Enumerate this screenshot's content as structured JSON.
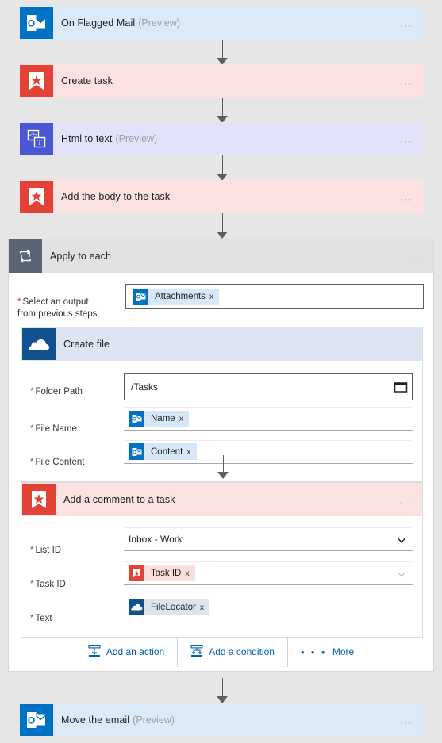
{
  "flow": {
    "steps": [
      {
        "id": "on-flagged-mail",
        "title": "On Flagged Mail",
        "suffix": "(Preview)",
        "connector": "outlook",
        "icon": "outlook-icon",
        "menu": "..."
      },
      {
        "id": "create-task",
        "title": "Create task",
        "suffix": "",
        "connector": "wunderlist",
        "icon": "wunderlist-icon",
        "menu": "..."
      },
      {
        "id": "html-to-text",
        "title": "Html to text",
        "suffix": "(Preview)",
        "connector": "html",
        "icon": "html-to-text-icon",
        "menu": "..."
      },
      {
        "id": "add-body-to-task",
        "title": "Add the body to the task",
        "suffix": "",
        "connector": "wunderlist",
        "icon": "wunderlist-icon",
        "menu": "..."
      },
      {
        "id": "move-the-email",
        "title": "Move the email",
        "suffix": "(Preview)",
        "connector": "outlook",
        "icon": "outlook-icon",
        "menu": "..."
      }
    ]
  },
  "loop": {
    "title": "Apply to each",
    "icon": "loop-icon",
    "menu": "...",
    "output_field": {
      "label": "Select an output\nfrom previous steps",
      "required": true,
      "token": {
        "text": "Attachments",
        "icon": "outlook-icon",
        "remove": "x"
      }
    },
    "actions": {
      "add_action": "Add an action",
      "add_action_icon": "add-action-icon",
      "add_condition": "Add a condition",
      "add_condition_icon": "add-condition-icon",
      "more": "More",
      "more_icon": "more-dots-icon"
    }
  },
  "create_file": {
    "title": "Create file",
    "suffix": "",
    "icon": "onedrive-icon",
    "menu": "...",
    "fields": [
      {
        "label": "Folder Path",
        "required": true,
        "type": "text",
        "value": "/Tasks",
        "trailing_icon": "folder-picker-icon"
      },
      {
        "label": "File Name",
        "required": true,
        "type": "token",
        "token": {
          "text": "Name",
          "icon": "outlook-icon",
          "remove": "x"
        }
      },
      {
        "label": "File Content",
        "required": true,
        "type": "token",
        "token": {
          "text": "Content",
          "icon": "outlook-icon",
          "remove": "x"
        }
      }
    ]
  },
  "add_comment": {
    "title": "Add a comment to a task",
    "suffix": "",
    "icon": "wunderlist-icon",
    "menu": "...",
    "fields": [
      {
        "label": "List ID",
        "required": true,
        "type": "select",
        "value": "Inbox - Work",
        "trailing_icon": "chevron-down-icon"
      },
      {
        "label": "Task ID",
        "required": true,
        "type": "token",
        "token": {
          "text": "Task ID",
          "icon": "wunderlist-icon",
          "remove": "x"
        },
        "trailing_icon": "chevron-down-icon"
      },
      {
        "label": "Text",
        "required": true,
        "type": "token",
        "token": {
          "text": "FileLocator",
          "icon": "onedrive-icon",
          "remove": "x"
        }
      }
    ]
  },
  "colors": {
    "canvas": "#e6e6e6",
    "outlook": "#0072c6",
    "outlook_tint": "#dbeaf7",
    "wunderlist": "#e44236",
    "wunderlist_tint": "#fbe2e0",
    "html": "#4a56d6",
    "html_tint": "#e2e3fa",
    "onedrive": "#12518f",
    "onedrive_tint": "#dde4f2",
    "loop_header": "#e1e1e1",
    "loop_tile": "#5a6472",
    "link": "#0062ad",
    "required": "#d13438",
    "connector": "#605e5c"
  }
}
